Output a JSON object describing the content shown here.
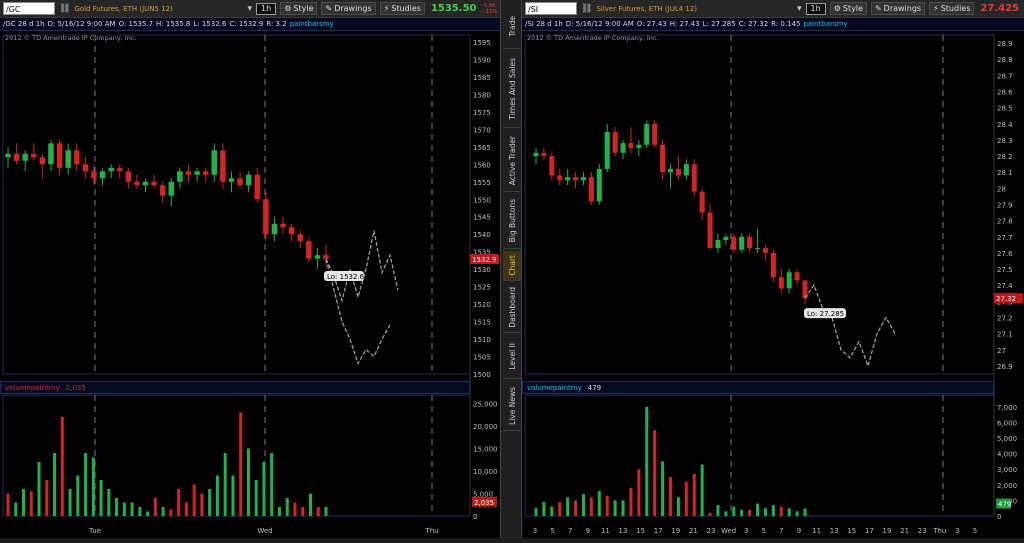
{
  "colors": {
    "up": "#21b34b",
    "down": "#d42424",
    "projection": "#a8a8a8",
    "study": "#19bfe4",
    "gold_last": "#3fd14a"
  },
  "left": {
    "symbol": "/GC",
    "description": "Gold Futures, ETH (JUN5 12)",
    "timeframe": "1h",
    "style_label": "Style",
    "drawings_label": "Drawings",
    "studies_label": "Studies",
    "last_price": "1535.50",
    "change": "-1.80",
    "change_pct": "-.11%",
    "ohlc": {
      "symbol": "/GC 28 d 1h",
      "date": "D: 5/16/12 9:00 AM",
      "open": "O: 1535.7",
      "high": "H: 1535.8",
      "low": "L: 1532.6",
      "close": "C: 1532.9",
      "range": "R: 3.2",
      "study": "paintbarsmy"
    },
    "copyright": "2012 © TD Ameritrade IP Company, Inc.",
    "price_axis": [
      "1595",
      "1590",
      "1585",
      "1580",
      "1575",
      "1570",
      "1565",
      "1560",
      "1555",
      "1550",
      "1545",
      "1540",
      "1535",
      "1530",
      "1525",
      "1520",
      "1515",
      "1510",
      "1505",
      "1500"
    ],
    "current_price_tag": "1532.9",
    "lo_label": "Lo: 1532.6",
    "volume_label": "volumepaintmy",
    "volume_value": "2,035",
    "volume_axis": [
      "25,000",
      "20,000",
      "15,000",
      "10,000",
      "5,000",
      "0"
    ],
    "volume_tag": "2,035",
    "time_axis": [
      "Tue",
      "Wed",
      "Thu"
    ]
  },
  "right": {
    "symbol": "/SI",
    "description": "Silver Futures, ETH (JUL4 12)",
    "timeframe": "1h",
    "style_label": "Style",
    "drawings_label": "Drawings",
    "studies_label": "Studies",
    "last_price": "27.425",
    "ohlc": {
      "symbol": "/SI 28 d 1h",
      "date": "D: 5/16/12 9:00 AM",
      "open": "O: 27.43",
      "high": "H: 27.43",
      "low": "L: 27.285",
      "close": "C: 27.32",
      "range": "R: 0.145",
      "study": "paintbarsmy"
    },
    "copyright": "2012 © TD Ameritrade IP Company, Inc.",
    "price_axis": [
      "28.9",
      "28.8",
      "28.7",
      "28.6",
      "28.5",
      "28.4",
      "28.3",
      "28.2",
      "28.1",
      "28",
      "27.9",
      "27.8",
      "27.7",
      "27.6",
      "27.5",
      "27.4",
      "27.3",
      "27.2",
      "27.1",
      "27",
      "26.9"
    ],
    "current_price_tag": "27.32",
    "lo_label": "Lo: 27.285",
    "volume_label": "volumepaintmy",
    "volume_value": "479",
    "volume_axis": [
      "7,000",
      "6,000",
      "5,000",
      "4,000",
      "3,000",
      "2,000",
      "1,000",
      "0"
    ],
    "volume_tag": "479",
    "time_axis": [
      "3",
      "5",
      "7",
      "9",
      "11",
      "13",
      "15",
      "17",
      "19",
      "21",
      "23",
      "Wed",
      "3",
      "5",
      "7",
      "9",
      "11",
      "13",
      "15",
      "17",
      "19",
      "21",
      "23",
      "Thu",
      "3",
      "5"
    ]
  },
  "side_tabs": [
    "Trade",
    "Times And Sales",
    "Active Trader",
    "Big Buttons",
    "Chart",
    "Dashboard",
    "Level II",
    "Live News"
  ],
  "active_tab": "Chart",
  "chart_data": [
    {
      "type": "candlestick",
      "title": "/GC 28 d 1h",
      "ylim": [
        1500,
        1597
      ],
      "candles": [
        [
          1562,
          1565,
          1559,
          1563
        ],
        [
          1563,
          1566,
          1560,
          1561
        ],
        [
          1561,
          1564,
          1558,
          1563
        ],
        [
          1563,
          1566,
          1561,
          1562
        ],
        [
          1562,
          1563,
          1556,
          1560
        ],
        [
          1560,
          1567,
          1558,
          1566
        ],
        [
          1566,
          1567,
          1557,
          1559
        ],
        [
          1559,
          1566,
          1557,
          1564
        ],
        [
          1564,
          1566,
          1558,
          1560
        ],
        [
          1560,
          1562,
          1556,
          1558
        ],
        [
          1558,
          1560,
          1554,
          1556
        ],
        [
          1556,
          1559,
          1554,
          1558
        ],
        [
          1558,
          1560,
          1556,
          1559
        ],
        [
          1559,
          1560,
          1556,
          1558
        ],
        [
          1558,
          1559,
          1553,
          1555
        ],
        [
          1555,
          1557,
          1553,
          1554
        ],
        [
          1554,
          1556,
          1552,
          1555
        ],
        [
          1555,
          1557,
          1553,
          1554
        ],
        [
          1554,
          1555,
          1549,
          1551
        ],
        [
          1551,
          1556,
          1548,
          1555
        ],
        [
          1555,
          1559,
          1553,
          1558
        ],
        [
          1558,
          1560,
          1555,
          1557
        ],
        [
          1557,
          1559,
          1555,
          1558
        ],
        [
          1558,
          1559,
          1555,
          1557
        ],
        [
          1557,
          1566,
          1555,
          1564
        ],
        [
          1564,
          1566,
          1553,
          1555
        ],
        [
          1555,
          1558,
          1552,
          1556
        ],
        [
          1556,
          1558,
          1553,
          1554
        ],
        [
          1554,
          1558,
          1552,
          1557
        ],
        [
          1557,
          1559,
          1549,
          1550
        ],
        [
          1550,
          1552,
          1538,
          1540
        ],
        [
          1540,
          1545,
          1538,
          1543
        ],
        [
          1543,
          1545,
          1540,
          1542
        ],
        [
          1542,
          1543,
          1538,
          1540
        ],
        [
          1540,
          1541,
          1536,
          1538
        ],
        [
          1538,
          1539,
          1532,
          1533
        ],
        [
          1533,
          1536,
          1530,
          1534
        ],
        [
          1534,
          1537,
          1531,
          1532.9
        ]
      ],
      "projection": [
        [
          1534,
          1528
        ],
        [
          1535,
          1521
        ],
        [
          1537,
          1530
        ],
        [
          1540,
          1522
        ],
        [
          1542,
          1530
        ],
        [
          1545,
          1541
        ],
        [
          1548,
          1529
        ],
        [
          1550,
          1534
        ],
        [
          1553,
          1524
        ]
      ],
      "projection_lower": [
        [
          1534,
          1524
        ],
        [
          1536,
          1515
        ],
        [
          1538,
          1510
        ],
        [
          1540,
          1503
        ],
        [
          1543,
          1507
        ],
        [
          1546,
          1505
        ],
        [
          1549,
          1510
        ],
        [
          1552,
          1514
        ]
      ],
      "volume_ylim": [
        0,
        26000
      ],
      "volume": [
        [
          5000,
          0
        ],
        [
          3000,
          1
        ],
        [
          6000,
          1
        ],
        [
          5500,
          0
        ],
        [
          12000,
          1
        ],
        [
          8000,
          0
        ],
        [
          14000,
          1
        ],
        [
          22000,
          0
        ],
        [
          6000,
          1
        ],
        [
          9000,
          1
        ],
        [
          14000,
          1
        ],
        [
          13000,
          1
        ],
        [
          8000,
          1
        ],
        [
          6000,
          1
        ],
        [
          4000,
          1
        ],
        [
          3000,
          1
        ],
        [
          3000,
          1
        ],
        [
          2000,
          1
        ],
        [
          1000,
          1
        ],
        [
          4000,
          0
        ],
        [
          2000,
          1
        ],
        [
          1500,
          0
        ],
        [
          6000,
          0
        ],
        [
          3000,
          0
        ],
        [
          7000,
          0
        ],
        [
          5000,
          0
        ],
        [
          6000,
          1
        ],
        [
          9000,
          1
        ],
        [
          14000,
          1
        ],
        [
          9000,
          1
        ],
        [
          23000,
          0
        ],
        [
          15000,
          1
        ],
        [
          8000,
          1
        ],
        [
          12000,
          1
        ],
        [
          14000,
          1
        ],
        [
          2000,
          1
        ],
        [
          4000,
          1
        ],
        [
          3000,
          0
        ],
        [
          2000,
          0
        ],
        [
          5000,
          1
        ],
        [
          2000,
          0
        ],
        [
          2035,
          1
        ]
      ]
    },
    {
      "type": "candlestick",
      "title": "/SI 28 d 1h",
      "ylim": [
        26.85,
        28.95
      ],
      "candles": [
        [
          28.2,
          28.25,
          28.15,
          28.22
        ],
        [
          28.22,
          28.25,
          28.18,
          28.2
        ],
        [
          28.2,
          28.22,
          28.05,
          28.08
        ],
        [
          28.08,
          28.12,
          28.02,
          28.05
        ],
        [
          28.05,
          28.12,
          28.02,
          28.07
        ],
        [
          28.07,
          28.1,
          28.0,
          28.05
        ],
        [
          28.05,
          28.1,
          28.02,
          28.07
        ],
        [
          28.07,
          28.1,
          27.9,
          27.92
        ],
        [
          27.92,
          28.15,
          27.9,
          28.12
        ],
        [
          28.12,
          28.4,
          28.1,
          28.35
        ],
        [
          28.35,
          28.38,
          28.2,
          28.22
        ],
        [
          28.22,
          28.3,
          28.18,
          28.28
        ],
        [
          28.28,
          28.38,
          28.22,
          28.25
        ],
        [
          28.25,
          28.3,
          28.2,
          28.27
        ],
        [
          28.27,
          28.42,
          28.25,
          28.4
        ],
        [
          28.4,
          28.42,
          28.25,
          28.27
        ],
        [
          28.27,
          28.3,
          28.05,
          28.1
        ],
        [
          28.1,
          28.15,
          28.0,
          28.12
        ],
        [
          28.12,
          28.2,
          28.05,
          28.08
        ],
        [
          28.08,
          28.18,
          28.05,
          28.15
        ],
        [
          28.15,
          28.18,
          27.95,
          27.98
        ],
        [
          27.98,
          28.0,
          27.8,
          27.85
        ],
        [
          27.85,
          27.9,
          27.62,
          27.63
        ],
        [
          27.63,
          27.72,
          27.6,
          27.68
        ],
        [
          27.68,
          27.72,
          27.65,
          27.7
        ],
        [
          27.7,
          27.72,
          27.6,
          27.62
        ],
        [
          27.62,
          27.72,
          27.6,
          27.7
        ],
        [
          27.7,
          27.72,
          27.6,
          27.63
        ],
        [
          27.63,
          27.75,
          27.6,
          27.63
        ],
        [
          27.63,
          27.65,
          27.55,
          27.6
        ],
        [
          27.6,
          27.62,
          27.42,
          27.45
        ],
        [
          27.45,
          27.5,
          27.35,
          27.38
        ],
        [
          27.38,
          27.5,
          27.35,
          27.48
        ],
        [
          27.48,
          27.5,
          27.4,
          27.43
        ],
        [
          27.43,
          27.43,
          27.285,
          27.32
        ]
      ],
      "projection": [
        [
          27.3,
          27.4
        ],
        [
          27.28,
          27.25
        ],
        [
          27.15,
          27.2
        ],
        [
          27.1,
          27.0
        ],
        [
          27.05,
          26.95
        ],
        [
          27.0,
          27.05
        ],
        [
          26.95,
          26.9
        ],
        [
          27.0,
          27.1
        ],
        [
          27.05,
          27.2
        ],
        [
          27.1,
          27.1
        ]
      ],
      "volume_ylim": [
        0,
        7500
      ],
      "volume": [
        [
          500,
          1
        ],
        [
          900,
          1
        ],
        [
          600,
          1
        ],
        [
          900,
          0
        ],
        [
          1200,
          1
        ],
        [
          1000,
          0
        ],
        [
          1400,
          1
        ],
        [
          1200,
          0
        ],
        [
          1600,
          1
        ],
        [
          1300,
          0
        ],
        [
          1000,
          1
        ],
        [
          1000,
          1
        ],
        [
          1800,
          0
        ],
        [
          3000,
          0
        ],
        [
          7000,
          1
        ],
        [
          5500,
          0
        ],
        [
          3500,
          1
        ],
        [
          2500,
          0
        ],
        [
          1200,
          1
        ],
        [
          2200,
          0
        ],
        [
          2700,
          0
        ],
        [
          3300,
          1
        ],
        [
          200,
          0
        ],
        [
          700,
          1
        ],
        [
          300,
          1
        ],
        [
          600,
          1
        ],
        [
          400,
          1
        ],
        [
          400,
          0
        ],
        [
          800,
          1
        ],
        [
          500,
          1
        ],
        [
          700,
          1
        ],
        [
          600,
          0
        ],
        [
          500,
          1
        ],
        [
          300,
          1
        ],
        [
          479,
          1
        ]
      ]
    }
  ]
}
